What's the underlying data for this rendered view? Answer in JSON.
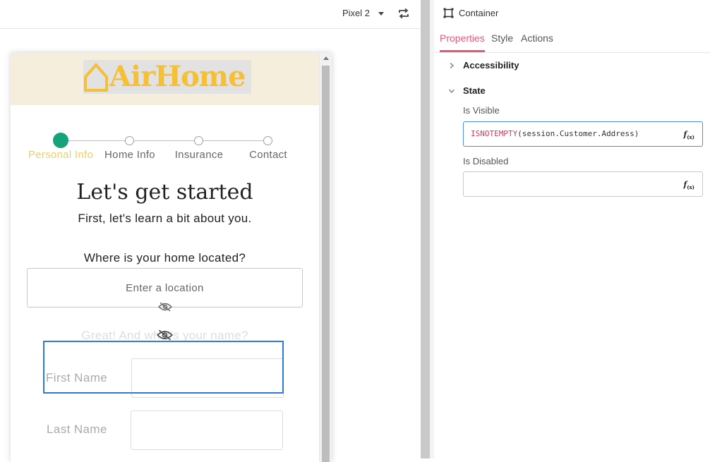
{
  "toolbar": {
    "device": "Pixel 2",
    "icons": {
      "caret": "caret-down-icon",
      "rotate": "rotate-device-icon"
    }
  },
  "app": {
    "brand": "AirHome",
    "brand_color": "#f5bf36",
    "header_bg": "#f6eedc",
    "steps": [
      {
        "label": "Personal Info",
        "active": true
      },
      {
        "label": "Home Info",
        "active": false
      },
      {
        "label": "Insurance",
        "active": false
      },
      {
        "label": "Contact",
        "active": false
      }
    ],
    "step_active_color": "#16a37b",
    "heading": "Let's get started",
    "subheading": "First, let's learn a bit about you.",
    "location_question": "Where is your home located?",
    "location_placeholder": "Enter a location",
    "name_question": "Great! And what's your name?",
    "first_name_label": "First Name",
    "last_name_label": "Last Name"
  },
  "panel": {
    "component": "Container",
    "tabs": [
      {
        "label": "Properties",
        "active": true
      },
      {
        "label": "Style",
        "active": false
      },
      {
        "label": "Actions",
        "active": false
      }
    ],
    "accent": "#e8577a",
    "sections": {
      "accessibility": "Accessibility",
      "state": "State"
    },
    "is_visible_label": "Is Visible",
    "is_visible_fn": "ISNOTEMPTY",
    "is_visible_args": "(session.Customer.Address)",
    "is_disabled_label": "Is Disabled",
    "fx": "f"
  }
}
